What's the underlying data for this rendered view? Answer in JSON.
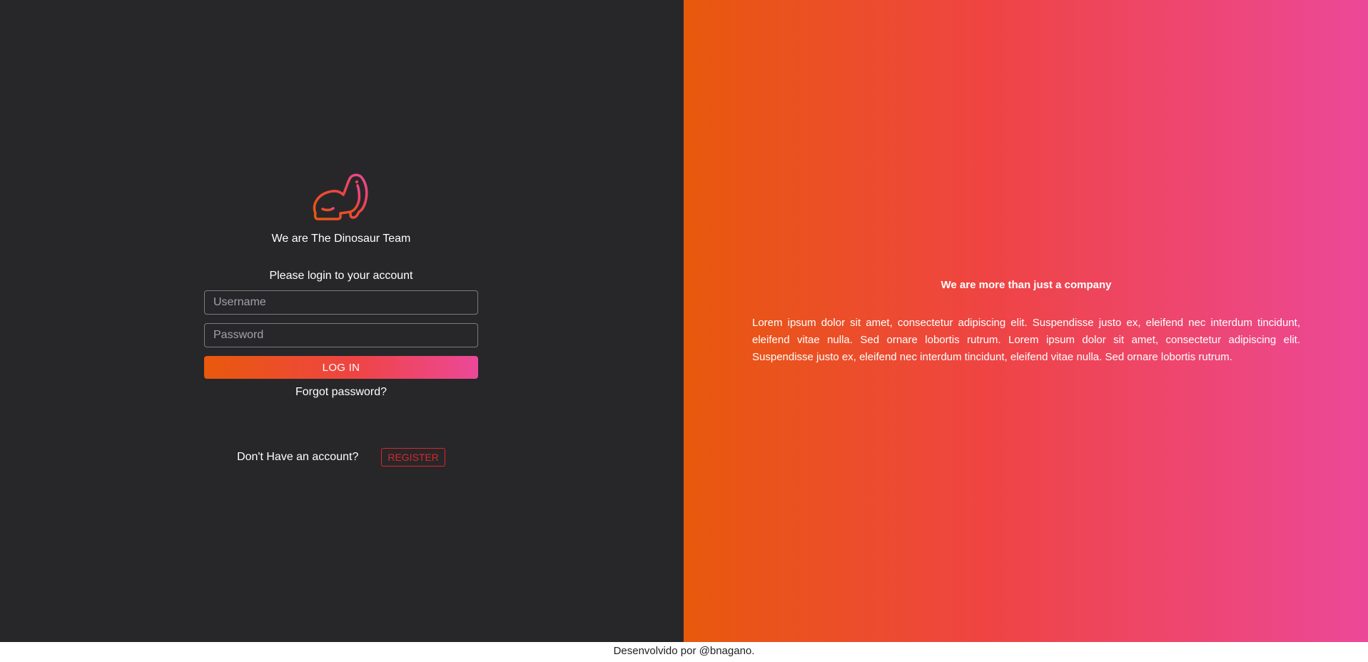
{
  "login": {
    "team_title": "We are The Dinosaur Team",
    "prompt": "Please login to your account",
    "username_placeholder": "Username",
    "password_placeholder": "Password",
    "login_label": "LOG IN",
    "forgot_label": "Forgot password?",
    "no_account_text": "Don't Have an account?",
    "register_label": "REGISTER"
  },
  "promo": {
    "title": "We are more than just a company",
    "body": "Lorem ipsum dolor sit amet, consectetur adipiscing elit. Suspendisse justo ex, eleifend nec interdum tincidunt, eleifend vitae nulla. Sed ornare lobortis rutrum. Lorem ipsum dolor sit amet, consectetur adipiscing elit. Suspendisse justo ex, eleifend nec interdum tincidunt, eleifend vitae nulla. Sed ornare lobortis rutrum."
  },
  "footer": {
    "credit": "Desenvolvido por @bnagano."
  },
  "icons": {
    "logo": "dinosaur-icon"
  },
  "colors": {
    "left_background": "#27272a",
    "gradient_start": "#e8590c",
    "gradient_mid": "#ef4444",
    "gradient_end": "#ec4899",
    "register_accent": "#dc2626"
  }
}
